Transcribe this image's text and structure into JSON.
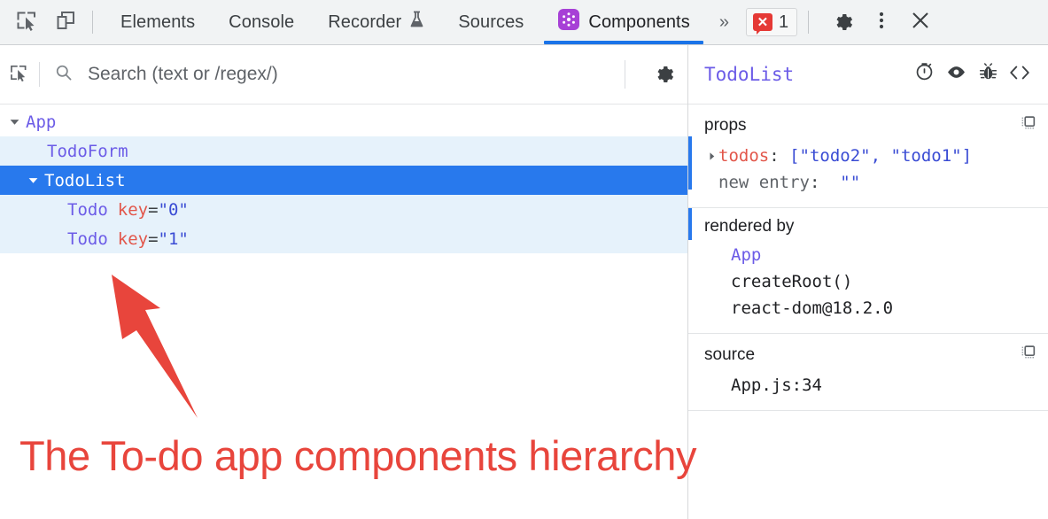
{
  "toolbar": {
    "inspect_icon": "inspect-element-icon",
    "device_icon": "device-toolbar-icon",
    "tabs": [
      {
        "label": "Elements",
        "active": false
      },
      {
        "label": "Console",
        "active": false
      },
      {
        "label": "Recorder",
        "active": false,
        "icon": "flask-icon"
      },
      {
        "label": "Sources",
        "active": false
      },
      {
        "label": "Components",
        "active": true,
        "icon": "react-logo-icon"
      }
    ],
    "overflow_label": "»",
    "error_count": "1",
    "error_icon": "error-bubble-icon",
    "settings_icon": "gear-icon",
    "more_icon": "kebab-menu-icon",
    "close_icon": "close-icon",
    "accent_color": "#1a73e8"
  },
  "search": {
    "select_icon": "select-component-icon",
    "search_icon": "search-icon",
    "placeholder": "Search (text or /regex/)",
    "value": "",
    "settings_icon": "gear-icon"
  },
  "tree": {
    "rows": [
      {
        "name": "App",
        "indent": 0,
        "expanded": true,
        "state": "normal",
        "key": ""
      },
      {
        "name": "TodoForm",
        "indent": 1,
        "expanded": null,
        "state": "hover",
        "key": ""
      },
      {
        "name": "TodoList",
        "indent": 1,
        "expanded": true,
        "state": "selected",
        "key": ""
      },
      {
        "name": "Todo",
        "indent": 2,
        "expanded": null,
        "state": "hover",
        "key": "key=\"0\"",
        "key_name": "key",
        "key_value": "\"0\""
      },
      {
        "name": "Todo",
        "indent": 2,
        "expanded": null,
        "state": "hover",
        "key": "key=\"1\"",
        "key_name": "key",
        "key_value": "\"1\""
      }
    ]
  },
  "inspector": {
    "title": "TodoList",
    "icons": [
      {
        "name": "stopwatch-icon"
      },
      {
        "name": "eye-icon"
      },
      {
        "name": "bug-icon"
      },
      {
        "name": "code-brackets-icon"
      }
    ],
    "props": {
      "title": "props",
      "copy_icon": "copy-to-clipboard-icon",
      "rows": [
        {
          "expandable": true,
          "key": "todos",
          "sep": ":",
          "value": "[\"todo2\", \"todo1\"]",
          "key_style": "orange",
          "value_style": "blue"
        },
        {
          "expandable": false,
          "key": "new entry",
          "sep": ":",
          "value": "\"\"",
          "key_style": "grey",
          "value_style": "blue"
        }
      ]
    },
    "rendered_by": {
      "title": "rendered by",
      "rows": [
        {
          "text": "App",
          "style": "purple"
        },
        {
          "text": "createRoot()",
          "style": "dark"
        },
        {
          "text": "react-dom@18.2.0",
          "style": "dark"
        }
      ]
    },
    "source": {
      "title": "source",
      "copy_icon": "copy-to-clipboard-icon",
      "rows": [
        {
          "text": "App.js:34",
          "style": "dark"
        }
      ]
    }
  },
  "annotation": {
    "arrow_name": "red-arrow-annotation",
    "text": "The To-do app components hierarchy",
    "color": "#e8453c"
  }
}
